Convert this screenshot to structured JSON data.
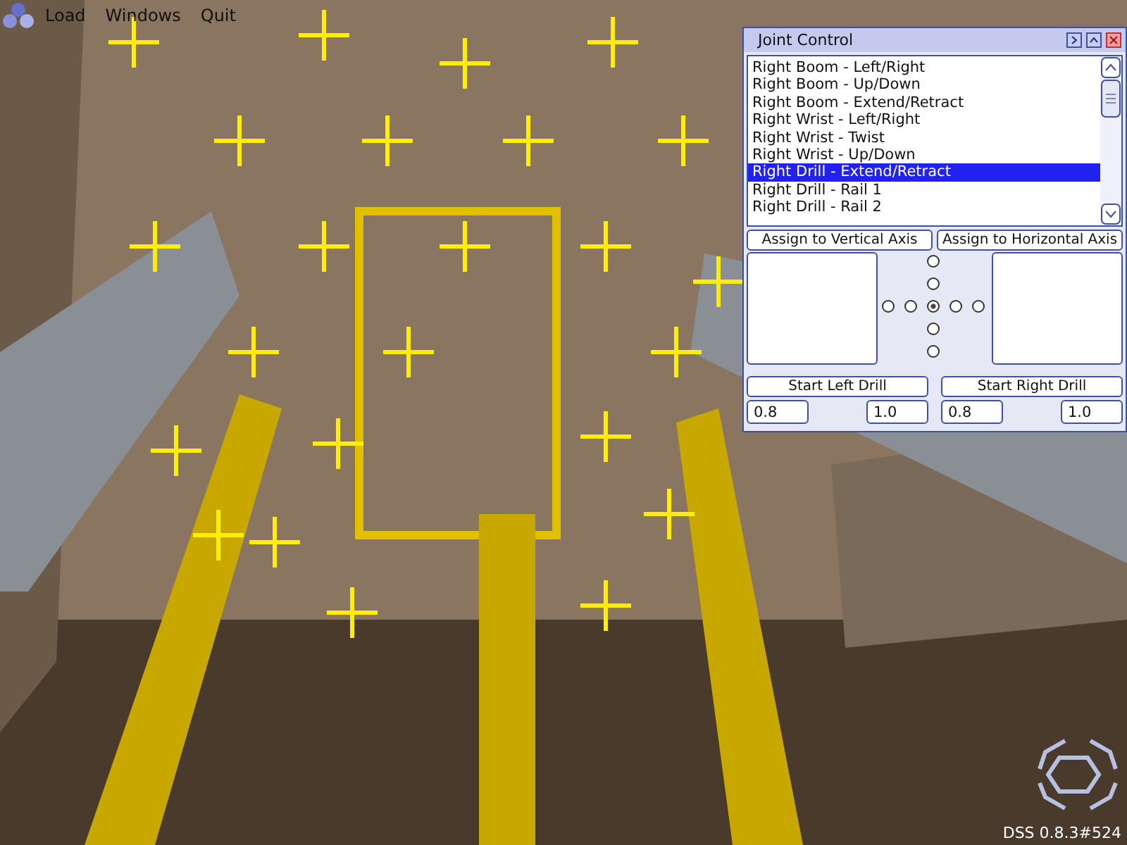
{
  "menu_bar": {
    "items": [
      "Load",
      "Windows",
      "Quit"
    ]
  },
  "joint_control": {
    "title": "Joint Control",
    "joints": [
      {
        "label": "Right Boom - Left/Right",
        "selected": false
      },
      {
        "label": "Right Boom - Up/Down",
        "selected": false
      },
      {
        "label": "Right Boom - Extend/Retract",
        "selected": false
      },
      {
        "label": "Right Wrist - Left/Right",
        "selected": false
      },
      {
        "label": "Right Wrist - Twist",
        "selected": false
      },
      {
        "label": "Right Wrist - Up/Down",
        "selected": false
      },
      {
        "label": "Right Drill - Extend/Retract",
        "selected": true
      },
      {
        "label": "Right Drill - Rail 1",
        "selected": false
      },
      {
        "label": "Right Drill - Rail 2",
        "selected": false
      }
    ],
    "assign_buttons": [
      "Assign to Vertical Axis",
      "Assign to Horizontal Axis"
    ],
    "axis_radios": [
      {
        "selected": false
      },
      {
        "selected": false
      },
      {
        "selected": false
      },
      {
        "selected": false
      },
      {
        "selected": true
      },
      {
        "selected": false
      },
      {
        "selected": false
      },
      {
        "selected": false
      },
      {
        "selected": false
      }
    ],
    "drills": [
      {
        "button": "Start Left Drill",
        "values": [
          "0.8",
          "1.0"
        ]
      },
      {
        "button": "Start Right Drill",
        "values": [
          "0.8",
          "1.0"
        ]
      }
    ]
  },
  "version": "DSS 0.8.3#524"
}
